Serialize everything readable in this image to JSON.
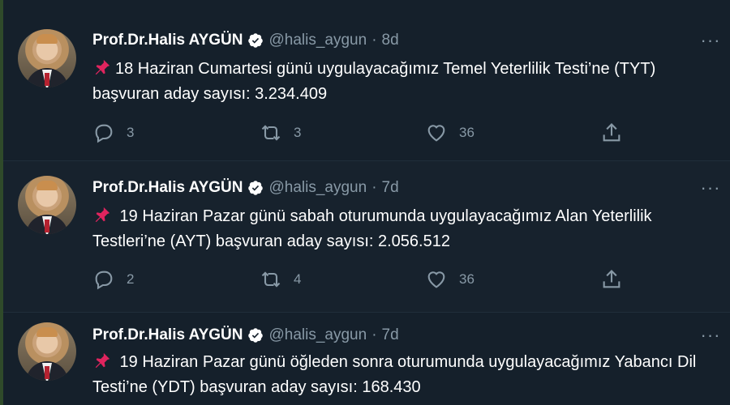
{
  "tweets": [
    {
      "author": "Prof.Dr.Halis AYGÜN",
      "handle": "@halis_aygun",
      "separator": "·",
      "time": "8d",
      "more": "···",
      "pin_icon": "pushpin-icon",
      "text": "18 Haziran Cumartesi günü uygulayacağımız Temel Yeterlilik Testi’ne (TYT) başvuran aday sayısı: 3.234.409",
      "replies": "3",
      "retweets": "3",
      "likes": "36"
    },
    {
      "author": "Prof.Dr.Halis AYGÜN",
      "handle": "@halis_aygun",
      "separator": "·",
      "time": "7d",
      "more": "···",
      "pin_icon": "pushpin-icon",
      "text": " 19 Haziran Pazar günü sabah oturumunda uygulayacağımız Alan Yeterlilik Testleri’ne (AYT) başvuran aday sayısı: 2.056.512",
      "replies": "2",
      "retweets": "4",
      "likes": "36"
    },
    {
      "author": "Prof.Dr.Halis AYGÜN",
      "handle": "@halis_aygun",
      "separator": "·",
      "time": "7d",
      "more": "···",
      "pin_icon": "pushpin-icon",
      "text": " 19 Haziran Pazar günü öğleden sonra oturumunda uygulayacağımız Yabancı Dil Testi’ne (YDT) başvuran aday sayısı: 168.430"
    }
  ],
  "colors": {
    "background": "#15202b",
    "secondary_text": "#8899a6",
    "verified_badge": "#ffffff",
    "pin": "#e0245e"
  }
}
